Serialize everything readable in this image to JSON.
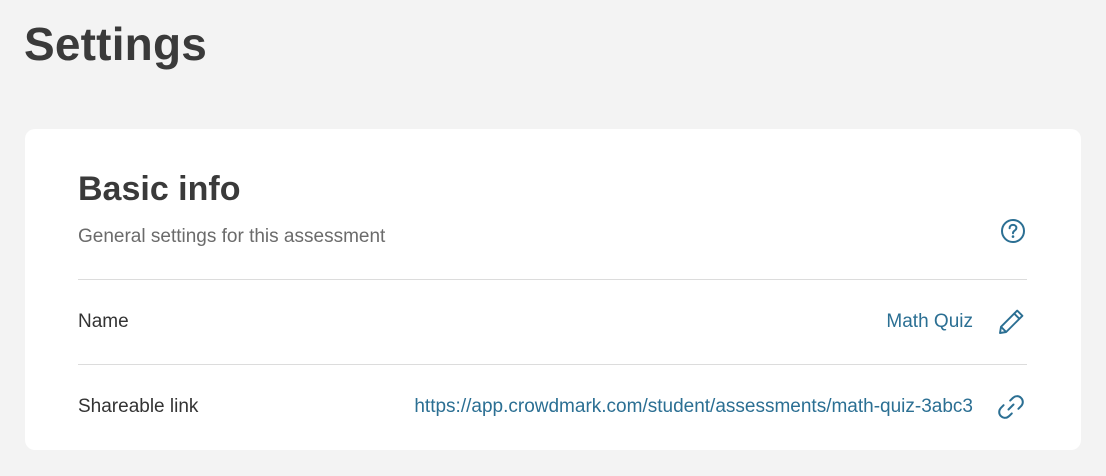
{
  "page": {
    "title": "Settings"
  },
  "basic_info": {
    "title": "Basic info",
    "subtitle": "General settings for this assessment",
    "help_icon": "question-circle-icon",
    "rows": [
      {
        "label": "Name",
        "value": "Math Quiz",
        "action_icon": "pencil-icon"
      },
      {
        "label": "Shareable link",
        "value": "https://app.crowdmark.com/student/assessments/math-quiz-3abc3",
        "action_icon": "link-icon"
      }
    ]
  },
  "colors": {
    "accent": "#2b6f93",
    "background": "#f3f3f3",
    "card": "#ffffff",
    "divider": "#dcdcdc"
  }
}
